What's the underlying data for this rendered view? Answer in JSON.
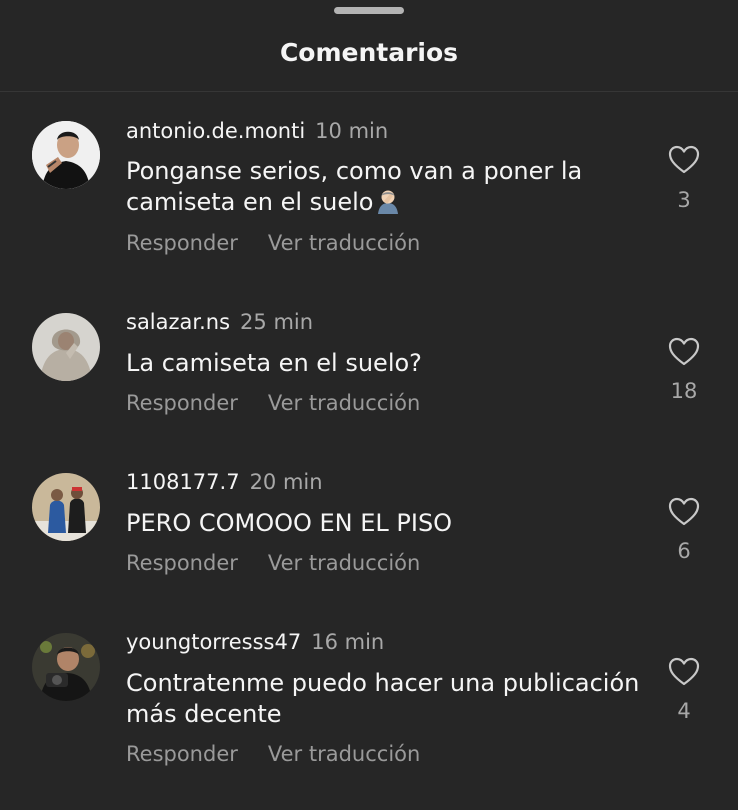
{
  "header": {
    "title": "Comentarios"
  },
  "comments": [
    {
      "username": "antonio.de.monti",
      "time": "10 min",
      "text": "Ponganse serios, como van a poner la camiseta en el suelo",
      "emoji": "person-facepalming",
      "reply_label": "Responder",
      "translate_label": "Ver traducción",
      "likes": "3",
      "like_icon": "heart-outline-icon"
    },
    {
      "username": "salazar.ns",
      "time": "25 min",
      "text": "La camiseta en el suelo?",
      "reply_label": "Responder",
      "translate_label": "Ver traducción",
      "likes": "18",
      "like_icon": "heart-outline-icon"
    },
    {
      "username": "1108177.7",
      "time": "20 min",
      "text": "PERO COMOOO EN EL PISO",
      "reply_label": "Responder",
      "translate_label": "Ver traducción",
      "likes": "6",
      "like_icon": "heart-outline-icon"
    },
    {
      "username": "youngtorresss47",
      "time": "16 min",
      "text": "Contratenme puedo hacer una publicación más decente",
      "reply_label": "Responder",
      "translate_label": "Ver traducción",
      "likes": "4",
      "like_icon": "heart-outline-icon"
    }
  ],
  "colors": {
    "background": "#262626",
    "text_primary": "#f5f5f5",
    "text_secondary": "#a8a8a8",
    "handle": "#b3b3b3"
  }
}
